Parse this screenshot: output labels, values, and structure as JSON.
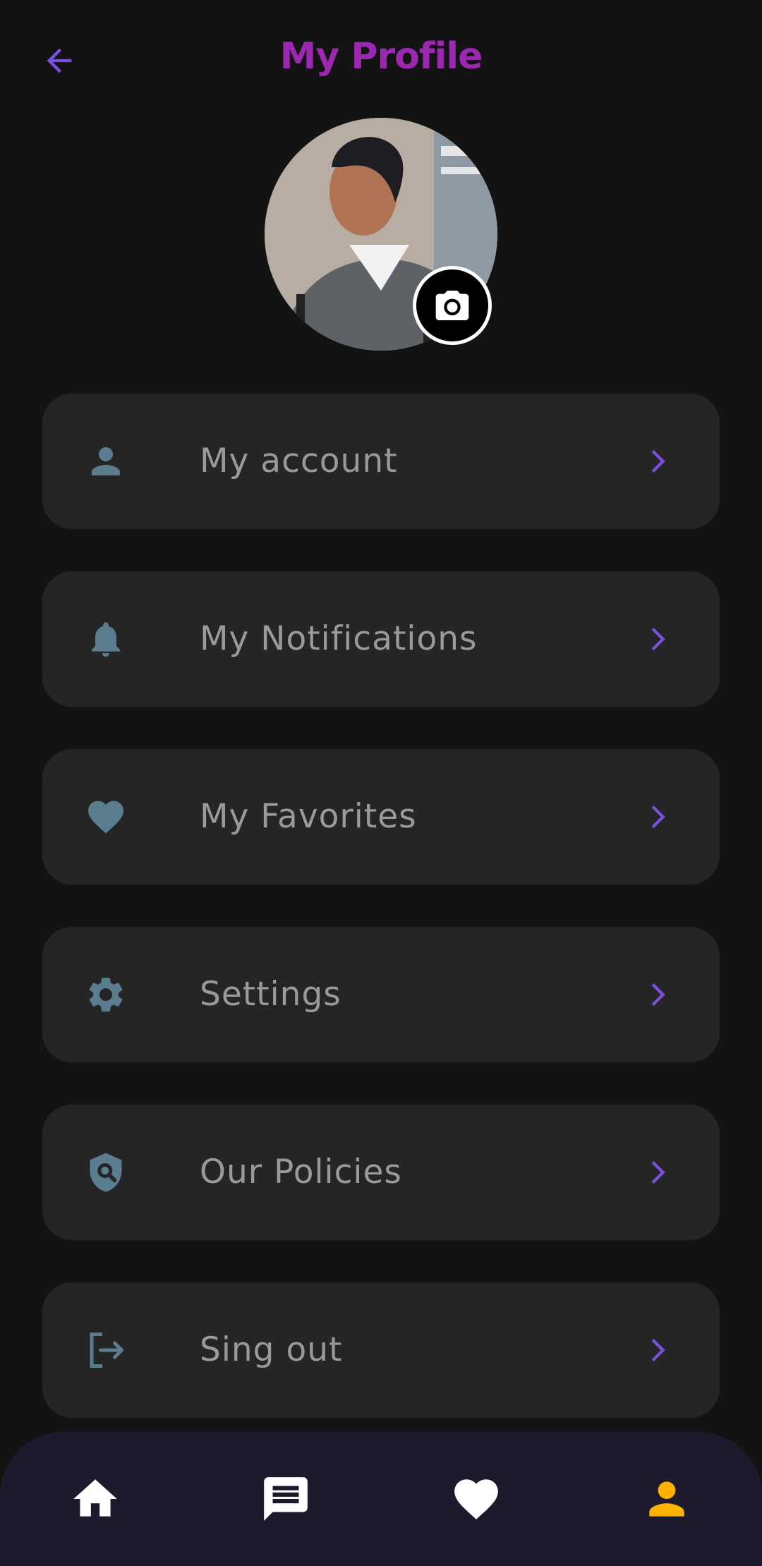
{
  "header": {
    "title": "My Profile"
  },
  "colors": {
    "background": "#131313",
    "title": "#9c27b0",
    "accent": "#7b4fe0",
    "menu_icon": "#5a7e8f",
    "menu_item_bg": "#252525",
    "nav_bg": "#1d1a2d",
    "nav_active": "#ffb300"
  },
  "menu": {
    "items": [
      {
        "label": "My account",
        "icon": "person-icon"
      },
      {
        "label": "My Notifications",
        "icon": "bell-icon"
      },
      {
        "label": "My Favorites",
        "icon": "heart-icon"
      },
      {
        "label": "Settings",
        "icon": "gear-icon"
      },
      {
        "label": "Our Policies",
        "icon": "shield-search-icon"
      },
      {
        "label": "Sing out",
        "icon": "logout-icon"
      }
    ]
  },
  "bottom_nav": {
    "items": [
      {
        "name": "home",
        "icon": "home-icon",
        "active": false
      },
      {
        "name": "chat",
        "icon": "chat-icon",
        "active": false
      },
      {
        "name": "favorites",
        "icon": "heart-icon",
        "active": false
      },
      {
        "name": "profile",
        "icon": "person-icon",
        "active": true
      }
    ]
  }
}
